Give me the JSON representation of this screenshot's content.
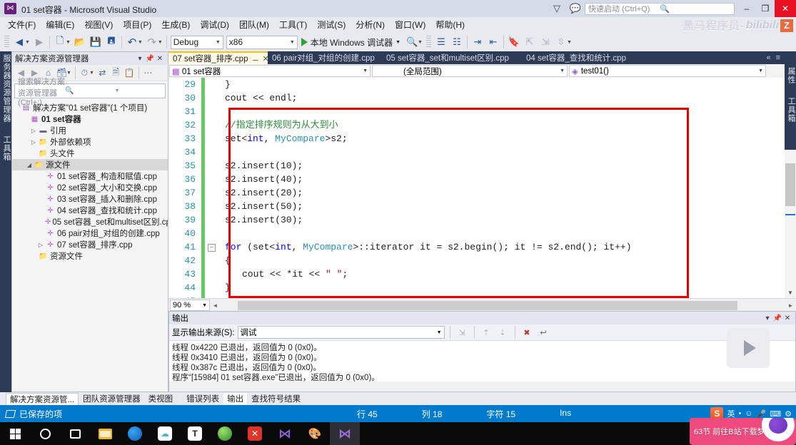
{
  "window": {
    "title": "01 set容器 - Microsoft Visual Studio",
    "logo_icon": "visual-studio-icon",
    "minimize": "–",
    "restore": "❐",
    "close": "✕",
    "feedback_icon": "feedback-icon",
    "funnel_icon": "funnel-icon",
    "quick_launch_placeholder": "快速启动 (Ctrl+Q)",
    "search_icon": "search-icon"
  },
  "brand": {
    "text_cn": "黑马程序员-",
    "text_b": "bilibili",
    "badge": "Z"
  },
  "menu": {
    "items": [
      "文件(F)",
      "编辑(E)",
      "视图(V)",
      "项目(P)",
      "生成(B)",
      "调试(D)",
      "团队(M)",
      "工具(T)",
      "测试(S)",
      "分析(N)",
      "窗口(W)",
      "帮助(H)"
    ]
  },
  "toolbar": {
    "nav_back_icon": "nav-back-icon",
    "nav_forward_icon": "nav-forward-icon",
    "new_project_icon": "new-project-icon",
    "open_file_icon": "open-file-icon",
    "save_icon": "save-icon",
    "save_all_icon": "save-all-icon",
    "undo_icon": "undo-icon",
    "redo_icon": "redo-icon",
    "config_value": "Debug",
    "platform_value": "x86",
    "run_label": "本地 Windows 调试器",
    "run_icon": "play-icon",
    "find_icon": "find-icon",
    "right_icons": [
      "comment-icon",
      "uncomment-icon",
      "indent-icon",
      "outdent-icon",
      "bookmark-icon",
      "prev-bookmark-icon",
      "next-bookmark-icon",
      "clear-bookmark-icon"
    ]
  },
  "left_dock": {
    "label_toolbox": "工具箱",
    "label_server": "服务器资源管理器"
  },
  "right_dock": {
    "label_properties": "属性",
    "label_toolbox": "工具箱"
  },
  "solution_explorer": {
    "title": "解决方案资源管理器",
    "dropdown_icon": "chevron-down-icon",
    "pin_icon": "pin-icon",
    "close_icon": "close-icon",
    "toolbar_icons": [
      "back-icon",
      "forward-icon",
      "home-icon",
      "view-icon",
      "chevron-down-icon",
      "pending-changes-icon",
      "chevron-down-icon",
      "refresh-icon",
      "show-all-files-icon",
      "properties-icon",
      "overflow-icon"
    ],
    "search_placeholder": "搜索解决方案资源管理器(Ctrl+;)",
    "search_icon": "search-icon",
    "search_dropdown_icon": "chevron-down-icon",
    "tree": [
      {
        "label": "解决方案\"01 set容器\"(1 个项目)",
        "indent": 0,
        "expander": "",
        "icon": "solution-icon",
        "bold": false,
        "selected": false
      },
      {
        "label": "01 set容器",
        "indent": 1,
        "expander": "",
        "icon": "project-icon",
        "bold": true,
        "selected": false
      },
      {
        "label": "引用",
        "indent": 2,
        "expander": "▷",
        "icon": "references-icon",
        "bold": false,
        "selected": false
      },
      {
        "label": "外部依赖项",
        "indent": 2,
        "expander": "▷",
        "icon": "folder-icon",
        "bold": false,
        "selected": false
      },
      {
        "label": "头文件",
        "indent": 2,
        "expander": "",
        "icon": "folder-icon",
        "bold": false,
        "selected": false
      },
      {
        "label": "源文件",
        "indent": 2,
        "expander": "◢",
        "icon": "folder-icon",
        "bold": false,
        "selected": true
      },
      {
        "label": "01 set容器_构造和赋值.cpp",
        "indent": 4,
        "expander": "",
        "icon": "cpp-file-icon",
        "bold": false,
        "selected": false
      },
      {
        "label": "02 set容器_大小和交换.cpp",
        "indent": 4,
        "expander": "",
        "icon": "cpp-file-icon",
        "bold": false,
        "selected": false
      },
      {
        "label": "03 set容器_插入和删除.cpp",
        "indent": 4,
        "expander": "",
        "icon": "cpp-file-icon",
        "bold": false,
        "selected": false
      },
      {
        "label": "04 set容器_查找和统计.cpp",
        "indent": 4,
        "expander": "",
        "icon": "cpp-file-icon",
        "bold": false,
        "selected": false
      },
      {
        "label": "05 set容器_set和multiset区别.cpp",
        "indent": 4,
        "expander": "",
        "icon": "cpp-file-icon",
        "bold": false,
        "selected": false
      },
      {
        "label": "06 pair对组_对组的创建.cpp",
        "indent": 4,
        "expander": "",
        "icon": "cpp-file-icon",
        "bold": false,
        "selected": false
      },
      {
        "label": "07 set容器_排序.cpp",
        "indent": 4,
        "expander": "▷",
        "icon": "cpp-file-icon",
        "bold": false,
        "selected": false
      },
      {
        "label": "资源文件",
        "indent": 2,
        "expander": "",
        "icon": "folder-icon",
        "bold": false,
        "selected": false
      }
    ]
  },
  "editor_tabs": {
    "tabs": [
      {
        "label": "07 set容器_排序.cpp",
        "active": true
      },
      {
        "label": "06 pair对组_对组的创建.cpp",
        "active": false
      },
      {
        "label": "05 set容器_set和multiset区别.cpp",
        "active": false
      },
      {
        "label": "04 set容器_查找和统计.cpp",
        "active": false
      }
    ],
    "pin_icon": "pin-icon",
    "close_icon": "close-icon",
    "overflow_icon": "chevron-left-icon",
    "tablist_icon": "tab-list-icon"
  },
  "nav_bar": {
    "project_icon": "project-icon",
    "project": "01 set容器",
    "scope": "(全局范围)",
    "member_icon": "method-icon",
    "member": "test01()",
    "dropdown_icon": "chevron-down-icon"
  },
  "code": {
    "lines": [
      {
        "num": 29,
        "indent": 2,
        "tokens": [
          {
            "t": "}",
            "c": "pl"
          }
        ]
      },
      {
        "num": 30,
        "indent": 2,
        "tokens": [
          {
            "t": "cout << endl;",
            "c": "pl"
          }
        ]
      },
      {
        "num": 31,
        "indent": 0,
        "tokens": []
      },
      {
        "num": 32,
        "indent": 2,
        "tokens": [
          {
            "t": "//指定排序规则为从大到小",
            "c": "cm"
          }
        ]
      },
      {
        "num": 33,
        "indent": 2,
        "tokens": [
          {
            "t": "set<",
            "c": "pl"
          },
          {
            "t": "int",
            "c": "kw"
          },
          {
            "t": ", ",
            "c": "pl"
          },
          {
            "t": "MyCompare",
            "c": "ty"
          },
          {
            "t": ">s2;",
            "c": "pl"
          }
        ]
      },
      {
        "num": 34,
        "indent": 0,
        "tokens": []
      },
      {
        "num": 35,
        "indent": 2,
        "tokens": [
          {
            "t": "s2.insert(10);",
            "c": "pl"
          }
        ]
      },
      {
        "num": 36,
        "indent": 2,
        "tokens": [
          {
            "t": "s2.insert(40);",
            "c": "pl"
          }
        ]
      },
      {
        "num": 37,
        "indent": 2,
        "tokens": [
          {
            "t": "s2.insert(20);",
            "c": "pl"
          }
        ]
      },
      {
        "num": 38,
        "indent": 2,
        "tokens": [
          {
            "t": "s2.insert(50);",
            "c": "pl"
          }
        ]
      },
      {
        "num": 39,
        "indent": 2,
        "tokens": [
          {
            "t": "s2.insert(30);",
            "c": "pl"
          }
        ]
      },
      {
        "num": 40,
        "indent": 0,
        "tokens": []
      },
      {
        "num": 41,
        "indent": 2,
        "tokens": [
          {
            "t": "for",
            "c": "kw"
          },
          {
            "t": " (set<",
            "c": "pl"
          },
          {
            "t": "int",
            "c": "kw"
          },
          {
            "t": ", ",
            "c": "pl"
          },
          {
            "t": "MyCompare",
            "c": "ty"
          },
          {
            "t": ">::iterator it = s2.begin(); it != s2.end(); it++)",
            "c": "pl"
          }
        ]
      },
      {
        "num": 42,
        "indent": 2,
        "tokens": [
          {
            "t": "{",
            "c": "pl"
          }
        ]
      },
      {
        "num": 43,
        "indent": 3,
        "tokens": [
          {
            "t": "cout << *it << ",
            "c": "pl"
          },
          {
            "t": "\" \"",
            "c": "st"
          },
          {
            "t": ";",
            "c": "pl"
          }
        ]
      },
      {
        "num": 44,
        "indent": 2,
        "tokens": [
          {
            "t": "}",
            "c": "pl"
          }
        ]
      },
      {
        "num": 45,
        "indent": 2,
        "tokens": [
          {
            "t": "cout << endl;",
            "c": "pl"
          }
        ]
      }
    ],
    "fold_markers": [
      41
    ],
    "zoom_level": "90 %",
    "highlight_note": "red-annotation-box"
  },
  "output": {
    "title": "输出",
    "dropdown_icon": "chevron-down-icon",
    "pin_icon": "pin-icon",
    "close_icon": "close-icon",
    "source_label": "显示输出来源(S):",
    "source_value": "调试",
    "toolbar_icons": [
      "jump-to-icon",
      "previous-icon",
      "next-icon",
      "clear-all-icon",
      "word-wrap-icon"
    ],
    "lines": [
      "线程 0x4220 已退出，返回值为 0 (0x0)。",
      "线程 0x3410 已退出，返回值为 0 (0x0)。",
      "线程 0x387c 已退出，返回值为 0 (0x0)。",
      "程序“[15984] 01 set容器.exe”已退出，返回值为 0 (0x0)。"
    ]
  },
  "bottom_tabs": [
    {
      "label": "解决方案资源管...",
      "state": "on"
    },
    {
      "label": "团队资源管理器",
      "state": ""
    },
    {
      "label": "类视图",
      "state": ""
    },
    {
      "label": "错误列表",
      "state": ""
    },
    {
      "label": "输出",
      "state": "sel2"
    },
    {
      "label": "查找符号结果",
      "state": ""
    }
  ],
  "status_bar": {
    "save_icon": "saved-item-icon",
    "message": "已保存的项",
    "line_label": "行 45",
    "col_label": "列 18",
    "char_label": "字符 15",
    "insert_mode": "Ins",
    "tray": {
      "sogou_badge": "S",
      "icons": [
        "ime-icon",
        "dot-icon",
        "emoji-icon",
        "mic-icon",
        "keyboard-icon",
        "settings-icon"
      ]
    }
  },
  "taskbar": {
    "items": [
      {
        "name": "start-button",
        "icon": "windows-logo-icon"
      },
      {
        "name": "cortana-button",
        "icon": "circle-icon"
      },
      {
        "name": "task-view-button",
        "icon": "task-view-icon"
      },
      {
        "name": "file-explorer",
        "icon": "folder-icon"
      },
      {
        "name": "browser",
        "icon": "qq-browser-icon"
      },
      {
        "name": "cloud-app",
        "icon": "cloud-icon"
      },
      {
        "name": "typora",
        "icon": "typora-icon"
      },
      {
        "name": "green-app",
        "icon": "green-sphere-icon"
      },
      {
        "name": "xmind",
        "icon": "xmind-icon"
      },
      {
        "name": "vscode",
        "icon": "vscode-icon"
      },
      {
        "name": "paint",
        "icon": "paint-icon"
      },
      {
        "name": "visual-studio",
        "icon": "visual-studio-icon",
        "active": true
      }
    ]
  },
  "overlay": {
    "play_button_icon": "video-play-icon",
    "promo_text": "63节 前往B站下载梦野",
    "promo_logo_icon": "brain-logo-icon"
  }
}
